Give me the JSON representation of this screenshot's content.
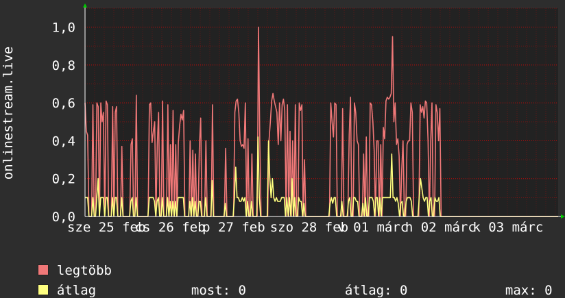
{
  "chart_data": {
    "type": "line",
    "ylabel": "onlinestream.live",
    "ylim": [
      0,
      1.1
    ],
    "yticks": [
      "0,0",
      "0,2",
      "0,4",
      "0,6",
      "0,8",
      "1,0"
    ],
    "ytick_values": [
      0,
      0.2,
      0.4,
      0.6,
      0.8,
      1.0
    ],
    "xticks": [
      "sze 25 feb",
      "cs 26 feb",
      "p 27 feb",
      "szo 28 feb",
      "v 01 márc",
      "h 02 márc",
      "k 03 márc"
    ],
    "grid": true,
    "legend_position": "bottom-left",
    "colors": {
      "legtobb": "#f07878",
      "atlag": "#ffff80",
      "grid": "#ff0000",
      "axis": "#ffffff",
      "arrow": "#00cc00",
      "background": "#2d2d2d",
      "plot_bg": "#222222"
    },
    "series": [
      {
        "name": "legtöbb",
        "values": [
          0.6,
          0.45,
          0.43,
          0,
          0,
          0,
          0.59,
          0,
          0,
          0.6,
          0.58,
          0,
          0.6,
          0.5,
          0.55,
          0,
          0.61,
          0.59,
          0,
          0,
          0,
          0.58,
          0,
          0.55,
          0.58,
          0,
          0,
          0,
          0.37,
          0,
          0,
          0,
          0,
          0,
          0,
          0.38,
          0.41,
          0,
          0,
          0.64,
          0,
          0,
          0,
          0,
          0,
          0,
          0,
          0,
          0,
          0.59,
          0.6,
          0.39,
          0.45,
          0.5,
          0,
          0.38,
          0.55,
          0,
          0,
          0.61,
          0,
          0,
          0,
          0.59,
          0,
          0.38,
          0,
          0.56,
          0,
          0.38,
          0,
          0.39,
          0.48,
          0.54,
          0.51,
          0.56,
          0,
          0,
          0,
          0,
          0.4,
          0,
          0.35,
          0,
          0.33,
          0,
          0,
          0.37,
          0.52,
          0,
          0,
          0,
          0.4,
          0,
          0,
          0,
          0,
          0.59,
          0,
          0,
          0,
          0,
          0,
          0,
          0,
          0,
          0,
          0.36,
          0,
          0,
          0,
          0,
          0,
          0,
          0.55,
          0.61,
          0.62,
          0.55,
          0.4,
          0.37,
          0.38,
          0.36,
          0.6,
          0,
          0.41,
          0,
          0,
          0.33,
          0,
          0,
          0,
          0,
          1.0,
          0.4,
          0,
          0,
          0,
          0,
          0,
          0,
          0.4,
          0.5,
          0.61,
          0.65,
          0.61,
          0.58,
          0.55,
          0.38,
          0.6,
          0.4,
          0.59,
          0.62,
          0.56,
          0,
          0.59,
          0,
          0.45,
          0,
          0.4,
          0,
          0.59,
          0,
          0,
          0.6,
          0.56,
          0.59,
          0,
          0.3,
          0,
          0,
          0,
          0,
          0,
          0,
          0,
          0,
          0,
          0,
          0,
          0,
          0,
          0,
          0,
          0,
          0,
          0,
          0,
          0.6,
          0.5,
          0.42,
          0.6,
          0.59,
          0,
          0,
          0,
          0,
          0.57,
          0,
          0,
          0,
          0,
          0.43,
          0.63,
          0,
          0,
          0.6,
          0.55,
          0.4,
          0.38,
          0,
          0,
          0,
          0.33,
          0,
          0.42,
          0,
          0,
          0.6,
          0.59,
          0.5,
          0.35,
          0,
          0.4,
          0.4,
          0,
          0.38,
          0,
          0.47,
          0.41,
          0.61,
          0.63,
          0.62,
          0.63,
          0.65,
          0.95,
          0.5,
          0.6,
          0.38,
          0.41,
          0.32,
          0,
          0.25,
          0.4,
          0,
          0,
          0.38,
          0.4,
          0.4,
          0.6,
          0.55,
          0,
          0,
          0,
          0,
          0,
          0.59,
          0.55,
          0.58,
          0.52,
          0.61,
          0.6,
          0.4,
          0,
          0.39,
          0.6,
          0,
          0,
          0.59,
          0.55,
          0.4,
          0.57,
          0,
          0,
          0,
          0,
          0,
          0,
          0,
          0,
          0,
          0,
          0,
          0,
          0,
          0,
          0,
          0,
          0,
          0,
          0,
          0,
          0,
          0,
          0,
          0,
          0,
          0,
          0,
          0,
          0,
          0,
          0,
          0,
          0,
          0,
          0,
          0,
          0,
          0,
          0,
          0,
          0,
          0,
          0,
          0,
          0,
          0,
          0,
          0,
          0,
          0,
          0,
          0,
          0,
          0,
          0,
          0,
          0,
          0,
          0,
          0,
          0,
          0,
          0,
          0,
          0,
          0,
          0,
          0,
          0,
          0,
          0,
          0,
          0,
          0,
          0,
          0,
          0,
          0,
          0,
          0,
          0,
          0,
          0,
          0,
          0,
          0,
          0,
          0,
          0,
          0
        ]
      },
      {
        "name": "átlag",
        "values": [
          0.1,
          0.1,
          0.1,
          0,
          0,
          0,
          0.1,
          0,
          0,
          0.1,
          0.2,
          0,
          0.1,
          0.1,
          0.1,
          0,
          0.1,
          0.1,
          0,
          0,
          0,
          0.1,
          0,
          0.1,
          0.1,
          0,
          0,
          0,
          0.1,
          0,
          0,
          0,
          0,
          0,
          0,
          0.08,
          0.1,
          0,
          0,
          0.1,
          0,
          0,
          0,
          0,
          0,
          0,
          0,
          0,
          0,
          0.1,
          0.1,
          0.1,
          0.1,
          0.08,
          0,
          0.08,
          0.1,
          0,
          0,
          0.1,
          0,
          0,
          0,
          0.1,
          0,
          0.08,
          0,
          0.08,
          0,
          0.08,
          0,
          0.1,
          0.1,
          0.1,
          0.1,
          0.1,
          0,
          0,
          0,
          0,
          0.08,
          0,
          0.1,
          0,
          0.08,
          0,
          0,
          0.08,
          0.08,
          0,
          0,
          0,
          0.1,
          0,
          0,
          0,
          0,
          0.19,
          0,
          0,
          0,
          0,
          0,
          0,
          0,
          0,
          0,
          0.07,
          0,
          0,
          0,
          0,
          0,
          0,
          0.1,
          0.26,
          0.1,
          0.1,
          0.08,
          0.08,
          0.1,
          0.08,
          0.1,
          0,
          0.08,
          0,
          0,
          0.08,
          0,
          0,
          0,
          0,
          0.42,
          0.1,
          0,
          0,
          0,
          0,
          0,
          0,
          0.4,
          0.2,
          0.1,
          0.2,
          0.1,
          0.08,
          0.1,
          0.08,
          0.08,
          0.08,
          0.1,
          0.1,
          0.1,
          0,
          0.1,
          0,
          0.1,
          0,
          0.2,
          0,
          0.1,
          0,
          0,
          0.1,
          0.08,
          0.08,
          0,
          0.07,
          0,
          0,
          0,
          0,
          0,
          0,
          0,
          0,
          0,
          0,
          0,
          0,
          0,
          0,
          0,
          0,
          0,
          0,
          0,
          0.07,
          0.1,
          0.07,
          0.1,
          0.1,
          0,
          0,
          0,
          0,
          0.08,
          0,
          0,
          0,
          0,
          0.08,
          0.1,
          0,
          0,
          0.1,
          0.1,
          0.08,
          0.08,
          0,
          0,
          0,
          0.07,
          0,
          0.1,
          0,
          0,
          0.1,
          0.1,
          0.1,
          0.08,
          0,
          0.1,
          0.1,
          0,
          0.1,
          0,
          0.1,
          0.1,
          0.1,
          0.1,
          0.1,
          0.1,
          0.1,
          0.33,
          0.1,
          0.1,
          0.08,
          0.1,
          0.07,
          0,
          0.07,
          0.08,
          0,
          0,
          0.08,
          0.1,
          0.1,
          0.1,
          0.08,
          0,
          0,
          0,
          0,
          0,
          0.1,
          0.2,
          0.15,
          0.1,
          0.08,
          0.1,
          0.1,
          0,
          0.08,
          0.1,
          0,
          0,
          0.1,
          0.08,
          0.08,
          0.1,
          0,
          0,
          0,
          0,
          0,
          0,
          0,
          0,
          0,
          0,
          0,
          0,
          0,
          0,
          0,
          0,
          0,
          0,
          0,
          0,
          0,
          0,
          0,
          0,
          0,
          0,
          0,
          0,
          0,
          0,
          0,
          0,
          0,
          0,
          0,
          0,
          0,
          0,
          0,
          0,
          0,
          0,
          0,
          0,
          0,
          0,
          0,
          0,
          0,
          0,
          0,
          0,
          0,
          0,
          0,
          0,
          0,
          0,
          0,
          0,
          0,
          0,
          0,
          0,
          0,
          0,
          0,
          0,
          0,
          0,
          0,
          0,
          0,
          0,
          0,
          0,
          0,
          0,
          0,
          0,
          0,
          0,
          0,
          0,
          0,
          0,
          0,
          0,
          0,
          0,
          0
        ]
      }
    ]
  },
  "legend": {
    "max_label": "legtöbb",
    "avg_label": "átlag",
    "now_label": "most:",
    "now_value": "0",
    "avg_stat_label": "átlag:",
    "avg_stat_value": "0",
    "max_stat_label": "max:",
    "max_stat_value": "0"
  }
}
